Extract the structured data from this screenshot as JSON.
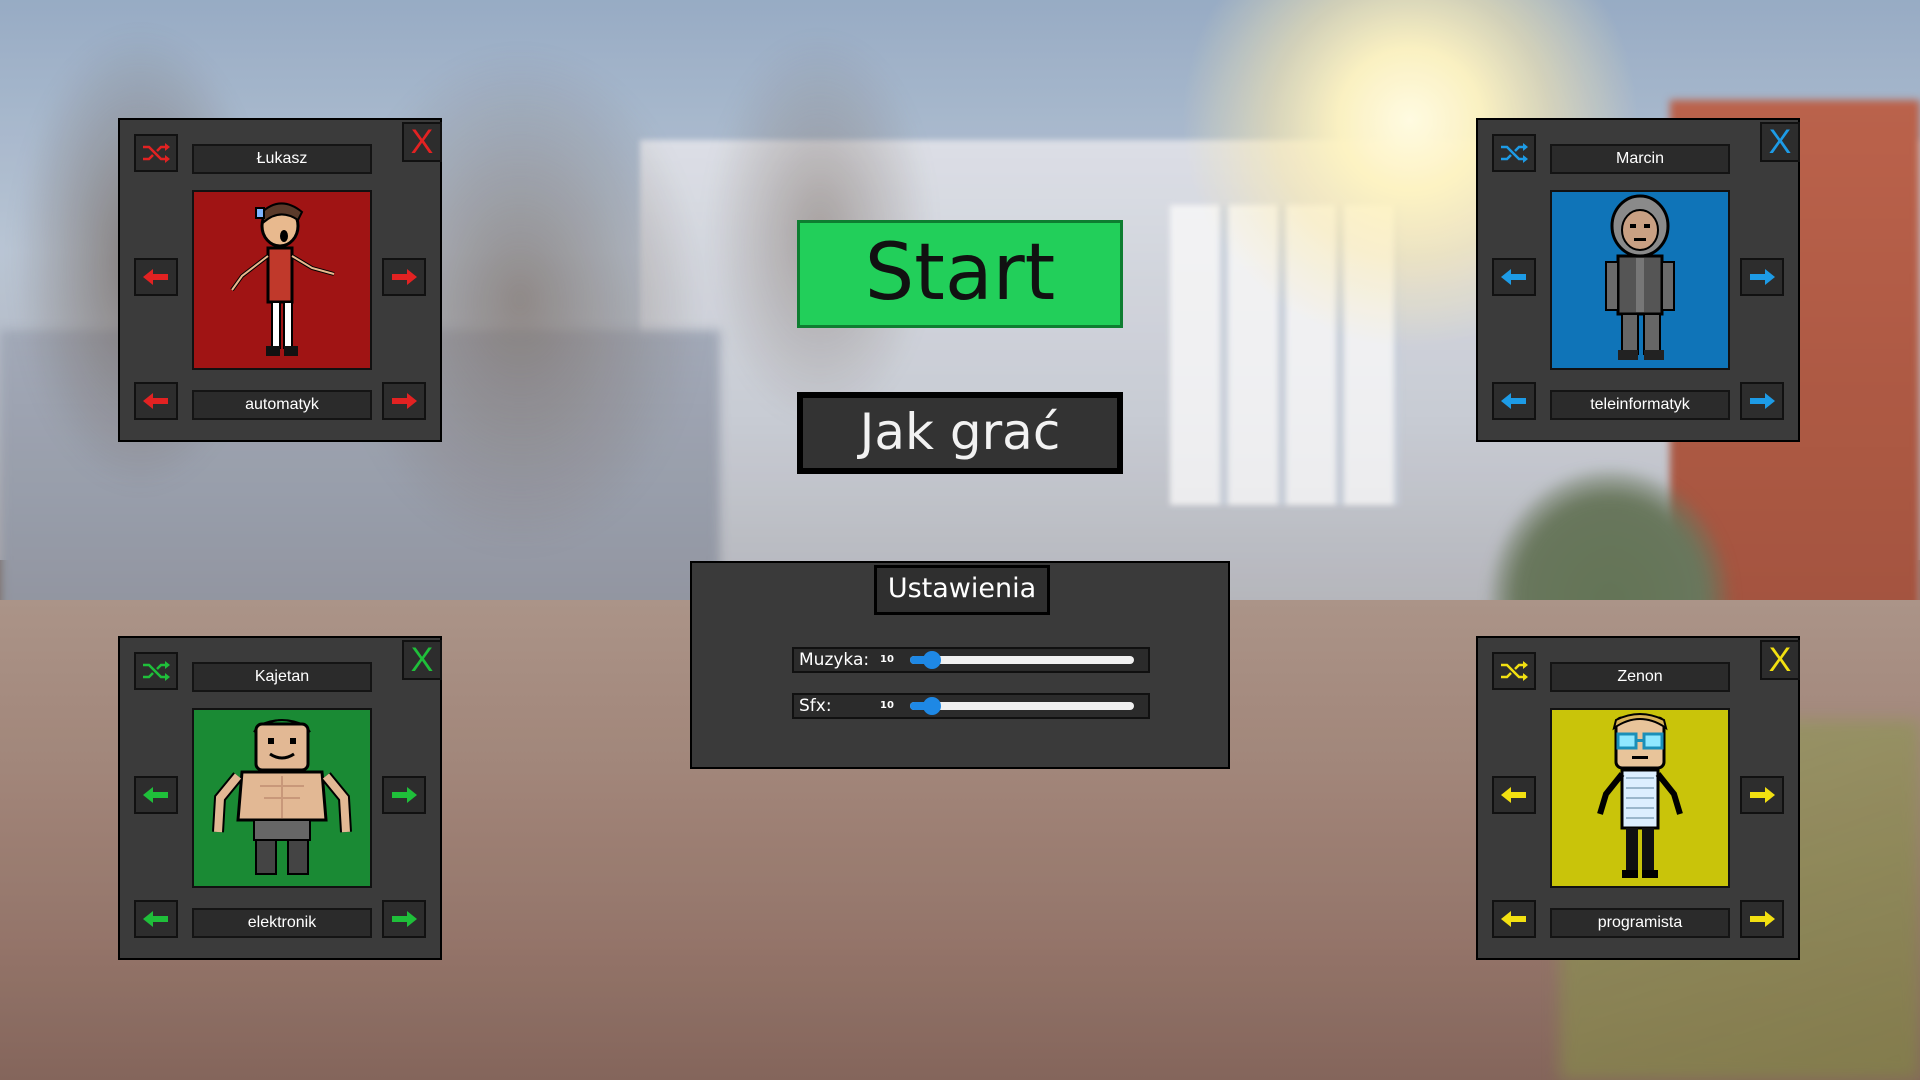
{
  "menu": {
    "start_label": "Start",
    "howto_label": "Jak grać"
  },
  "settings": {
    "title": "Ustawienia",
    "music": {
      "label": "Muzyka:",
      "value": "10",
      "level_fraction": 0.1
    },
    "sfx": {
      "label": "Sfx:",
      "value": "10",
      "level_fraction": 0.1
    }
  },
  "players": [
    {
      "name": "Łukasz",
      "role": "automatyk",
      "close_label": "X",
      "accent": "#e22222",
      "portrait_bg": "#a01414",
      "icons": {
        "shuffle": "shuffle-icon",
        "arrow_left": "arrow-left-icon",
        "arrow_right": "arrow-right-icon"
      }
    },
    {
      "name": "Marcin",
      "role": "teleinformatyk",
      "close_label": "X",
      "accent": "#1d9be6",
      "portrait_bg": "#0f74b8",
      "icons": {
        "shuffle": "shuffle-icon",
        "arrow_left": "arrow-left-icon",
        "arrow_right": "arrow-right-icon"
      }
    },
    {
      "name": "Kajetan",
      "role": "elektronik",
      "close_label": "X",
      "accent": "#1fbf3a",
      "portrait_bg": "#1a8a34",
      "icons": {
        "shuffle": "shuffle-icon",
        "arrow_left": "arrow-left-icon",
        "arrow_right": "arrow-right-icon"
      }
    },
    {
      "name": "Zenon",
      "role": "programista",
      "close_label": "X",
      "accent": "#f2e011",
      "portrait_bg": "#c9c40a",
      "icons": {
        "shuffle": "shuffle-icon",
        "arrow_left": "arrow-left-icon",
        "arrow_right": "arrow-right-icon"
      }
    }
  ]
}
